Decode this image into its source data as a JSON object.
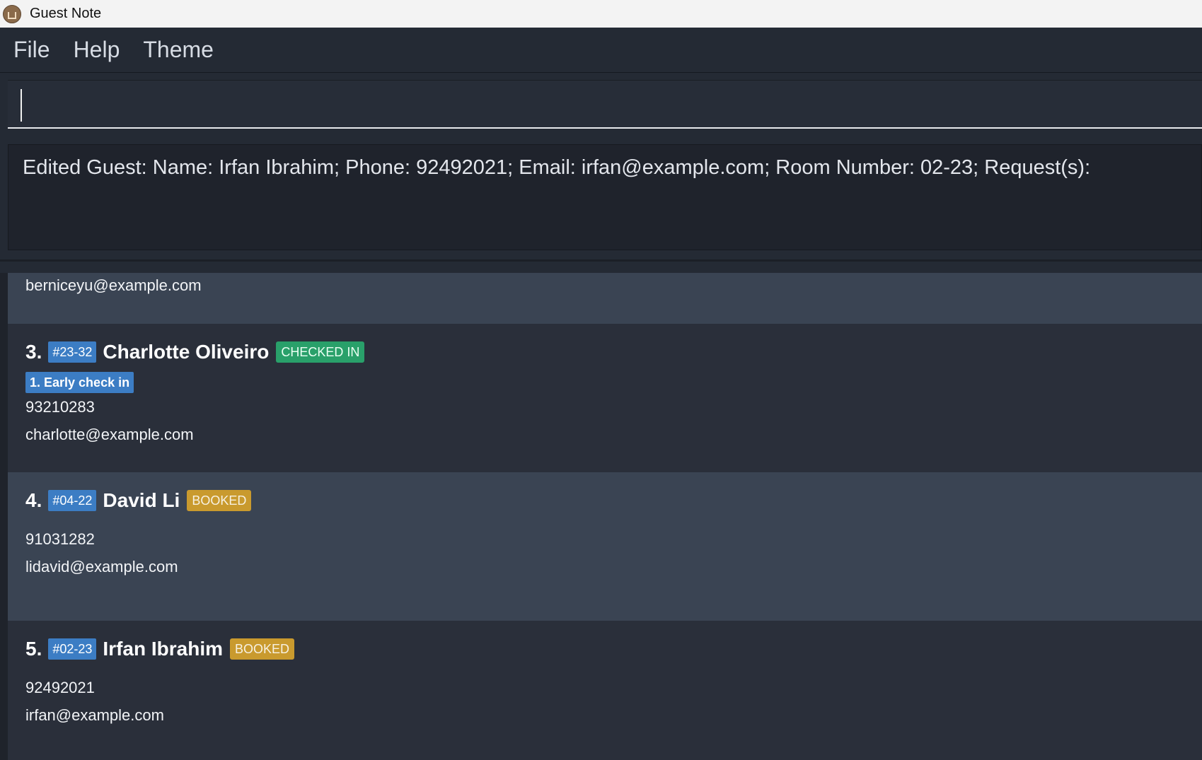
{
  "window": {
    "title": "Guest Note"
  },
  "menu": {
    "items": [
      "File",
      "Help",
      "Theme"
    ]
  },
  "command": {
    "value": ""
  },
  "result": {
    "text": "Edited Guest: Name: Irfan Ibrahim; Phone: 92492021; Email: irfan@example.com; Room Number: 02-23; Request(s):"
  },
  "guests": {
    "partial": {
      "email": "berniceyu@example.com"
    },
    "items": [
      {
        "index": "3.",
        "room": "#23-32",
        "name": "Charlotte Oliveiro",
        "status": "CHECKED IN",
        "request": "1. Early check in",
        "phone": "93210283",
        "email": "charlotte@example.com"
      },
      {
        "index": "4.",
        "room": "#04-22",
        "name": "David Li",
        "status": "BOOKED",
        "phone": "91031282",
        "email": "lidavid@example.com"
      },
      {
        "index": "5.",
        "room": "#02-23",
        "name": "Irfan Ibrahim",
        "status": "BOOKED",
        "phone": "92492021",
        "email": "irfan@example.com"
      }
    ]
  },
  "colors": {
    "room_tag": "#3c7dc4",
    "checked_in": "#29a06a",
    "booked": "#c99a2e"
  }
}
